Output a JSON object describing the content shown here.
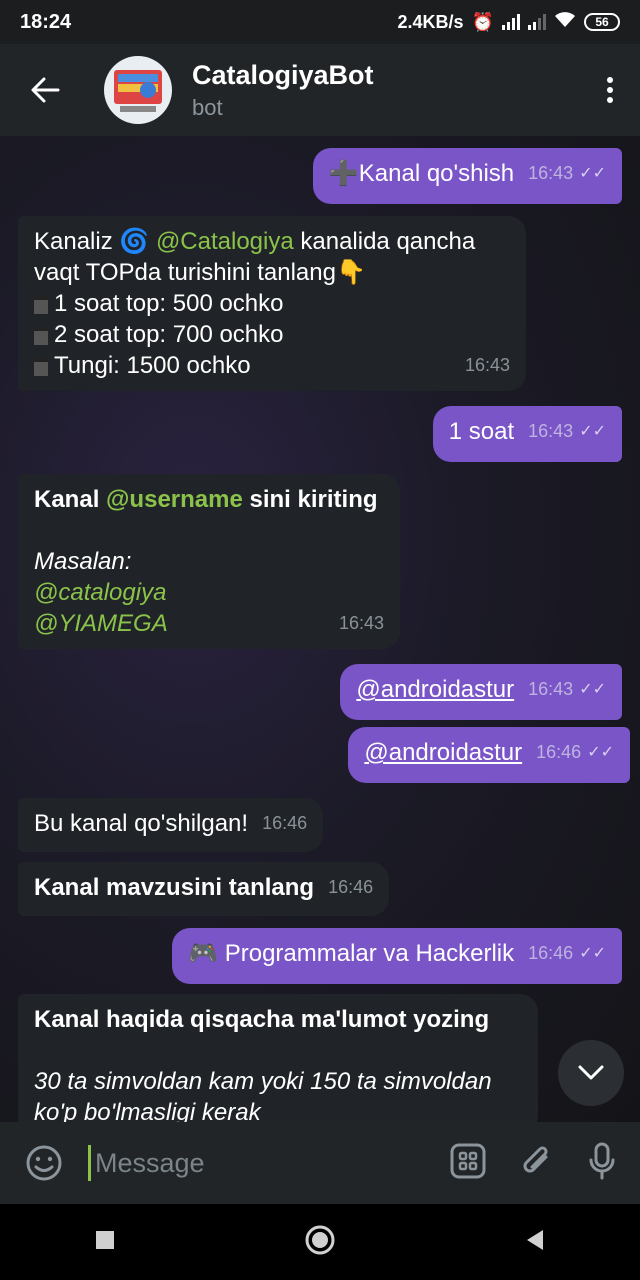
{
  "status": {
    "time": "18:24",
    "speed": "2.4KB/s",
    "battery": "56"
  },
  "header": {
    "title": "CatalogiyaBot",
    "subtitle": "bot"
  },
  "messages": {
    "m1": {
      "text": "➕Kanal qo'shish",
      "time": "16:43"
    },
    "m2": {
      "prefix": "Kanaliz 🌀 ",
      "mention": "@Catalogiya",
      "suffix": " kanalida qancha vaqt TOPda turishini tanlang👇",
      "items": [
        "1 soat top: 500 ochko",
        "2 soat top: 700 ochko",
        "Tungi: 1500 ochko"
      ],
      "time": "16:43"
    },
    "m3": {
      "text": "1 soat",
      "time": "16:43"
    },
    "m4": {
      "prefix": "Kanal ",
      "mention": "@username",
      "suffix": " sini kiriting",
      "example_label": "Masalan:",
      "examples": [
        "@catalogiya",
        "@YIAMEGA"
      ],
      "time": "16:43"
    },
    "m5": {
      "text": "@androidastur",
      "time": "16:43"
    },
    "m6": {
      "text": "@androidastur",
      "time": "16:46"
    },
    "m7": {
      "text": "Bu kanal qo'shilgan!",
      "time": "16:46"
    },
    "m8": {
      "text": "Kanal mavzusini tanlang",
      "time": "16:46"
    },
    "m9": {
      "text": "🎮 Programmalar va Hackerlik",
      "time": "16:46"
    },
    "m10": {
      "title": "Kanal haqida qisqacha ma'lumot yozing",
      "body": "30 ta simvoldan kam yoki 150 ta simvoldan ko'p bo'lmasligi kerak"
    }
  },
  "composer": {
    "placeholder": "Message"
  },
  "colors": {
    "accent": "#8bc34a",
    "outgoing": "#7a55c8",
    "incoming": "#202428"
  }
}
